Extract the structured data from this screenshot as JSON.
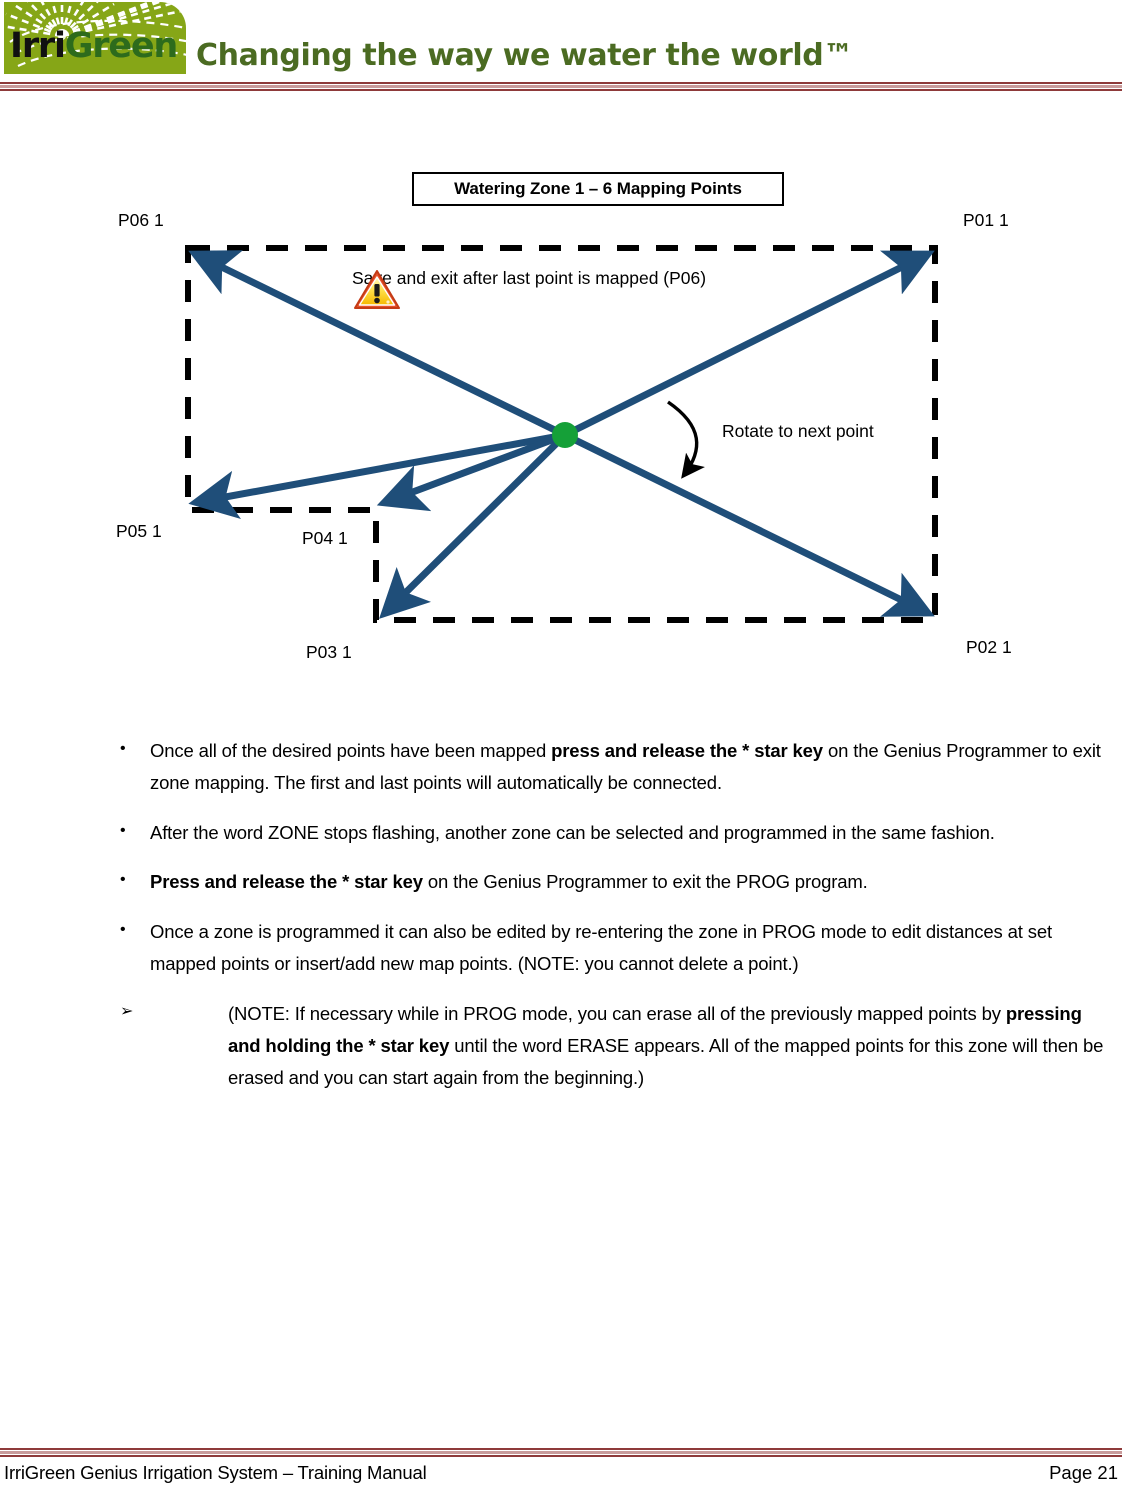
{
  "header": {
    "logo_text_part1": "Irri",
    "logo_text_part2": "Green",
    "logo_icon": "sprinkler-spray-logo",
    "tagline": "Changing the way we water the world™",
    "brand_green": "#86a617",
    "logo_dark_green": "#2d6b1c",
    "tagline_color": "#4b6b22",
    "rule_colors": [
      "#8e3a3a",
      "#c99b9b",
      "#8e3a3a"
    ]
  },
  "diagram": {
    "title": "Watering Zone 1 – 6 Mapping Points",
    "warning_icon": "warning-triangle-icon",
    "warning_text": "Save and exit after last point is mapped (P06)",
    "rotate_note": "Rotate to next point",
    "head_color": "#15a038",
    "arrow_color": "#1f4e79",
    "boundary_style": "dashed",
    "point_labels": {
      "p06": "P06 1",
      "p01": "P01 1",
      "p05": "P05 1",
      "p04": "P04 1",
      "p03": "P03 1",
      "p02": "P02 1"
    }
  },
  "content": {
    "bullets": [
      {
        "marker": "•",
        "parts": [
          {
            "text": "Once all of the desired points have been mapped ",
            "bold": false
          },
          {
            "text": "press and release the * star key",
            "bold": true
          },
          {
            "text": " on the Genius Programmer to exit zone mapping.  The first and last points will automatically be connected.",
            "bold": false
          }
        ]
      },
      {
        "marker": "•",
        "parts": [
          {
            "text": "After the word ZONE stops flashing, another zone can be selected and programmed in the same fashion.",
            "bold": false
          }
        ]
      },
      {
        "marker": "•",
        "parts": [
          {
            "text": "Press and release the * star key",
            "bold": true
          },
          {
            "text": " on the Genius Programmer to exit the PROG program.",
            "bold": false
          }
        ]
      },
      {
        "marker": "•",
        "parts": [
          {
            "text": "Once a zone is programmed it can also be edited by re-entering the zone in PROG mode to edit distances at set mapped points or insert/add new map points. (NOTE: you cannot delete a point.)",
            "bold": false
          }
        ]
      },
      {
        "marker": "➢",
        "sub": true,
        "parts": [
          {
            "text": "(NOTE: If necessary while in PROG mode, you can erase all of the previously mapped points by ",
            "bold": false
          },
          {
            "text": "pressing and holding the * star key",
            "bold": true
          },
          {
            "text": " until the word ERASE appears.  All of the mapped points for this zone will then be erased and you can start again from the beginning.)",
            "bold": false
          }
        ]
      }
    ]
  },
  "footer": {
    "left": "IrriGreen Genius Irrigation System – Training Manual",
    "right": "Page 21"
  }
}
